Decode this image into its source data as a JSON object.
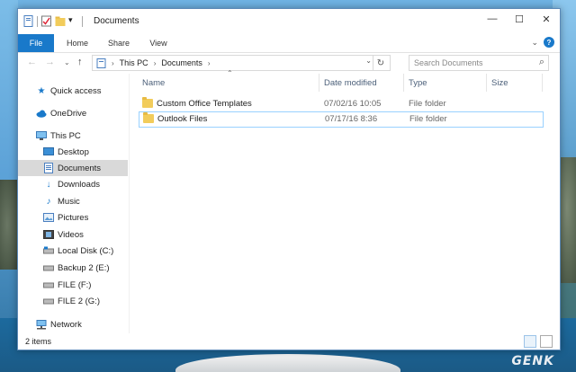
{
  "window": {
    "title": "Documents",
    "controls": {
      "minimize": "—",
      "maximize": "☐",
      "close": "✕"
    }
  },
  "ribbon": {
    "tabs": [
      "File",
      "Home",
      "Share",
      "View"
    ],
    "help": "?",
    "collapse": "⌄"
  },
  "navigation": {
    "back": "←",
    "forward": "→",
    "recent": "⌄",
    "up": "↑",
    "breadcrumb": [
      "This PC",
      "Documents"
    ],
    "search_placeholder": "Search Documents"
  },
  "sidebar": {
    "items": [
      {
        "label": "Quick access",
        "icon": "star-icon"
      },
      {
        "label": "OneDrive",
        "icon": "cloud-icon"
      },
      {
        "label": "This PC",
        "icon": "computer-icon"
      },
      {
        "label": "Desktop",
        "icon": "desktop-icon"
      },
      {
        "label": "Documents",
        "icon": "documents-icon",
        "selected": true
      },
      {
        "label": "Downloads",
        "icon": "download-icon"
      },
      {
        "label": "Music",
        "icon": "music-icon"
      },
      {
        "label": "Pictures",
        "icon": "pictures-icon"
      },
      {
        "label": "Videos",
        "icon": "videos-icon"
      },
      {
        "label": "Local Disk (C:)",
        "icon": "drive-icon"
      },
      {
        "label": "Backup 2 (E:)",
        "icon": "drive-icon"
      },
      {
        "label": "FILE (F:)",
        "icon": "drive-icon"
      },
      {
        "label": "FILE 2 (G:)",
        "icon": "drive-icon"
      },
      {
        "label": "Network",
        "icon": "network-icon"
      }
    ]
  },
  "files": {
    "columns": [
      "Name",
      "Date modified",
      "Type",
      "Size"
    ],
    "rows": [
      {
        "name": "Custom Office Templates",
        "date": "07/02/16 10:05",
        "type": "File folder",
        "size": ""
      },
      {
        "name": "Outlook Files",
        "date": "07/17/16 8:36",
        "type": "File folder",
        "size": ""
      }
    ]
  },
  "status": {
    "count": "2 items"
  },
  "watermark": {
    "logo": "GENK"
  },
  "colors": {
    "accent": "#1979ca",
    "selection": "#d9d9d9",
    "folder": "#f2cc5b"
  }
}
